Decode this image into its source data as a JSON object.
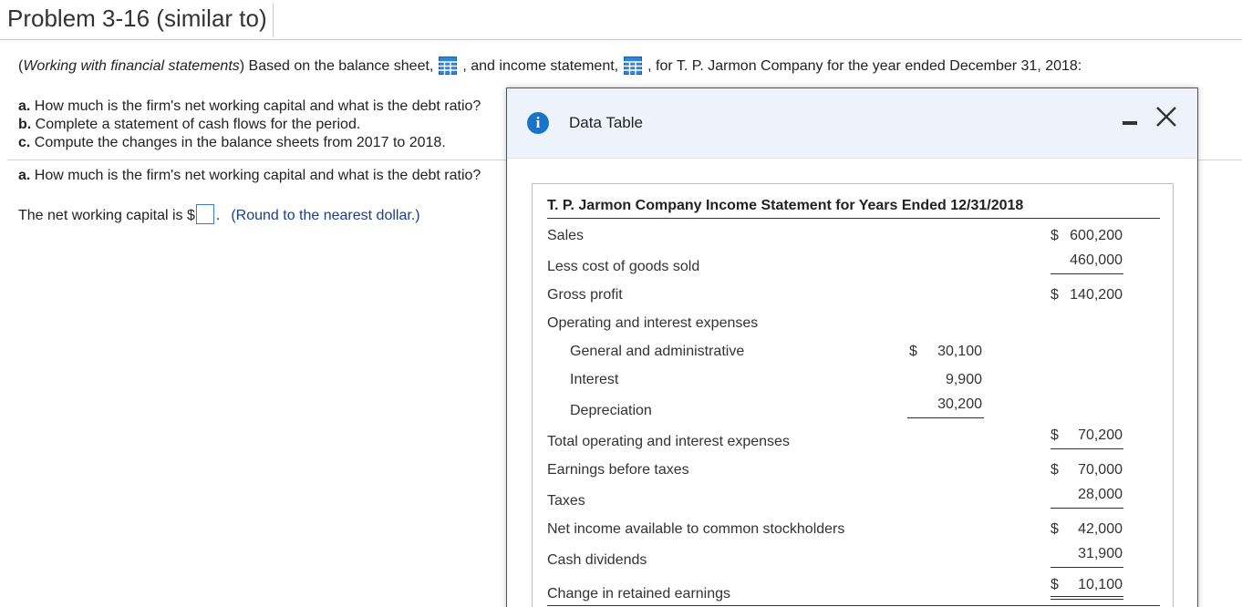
{
  "page": {
    "title": "Problem 3-16 (similar to)",
    "intro_italic": "Working with financial statements",
    "intro_pre": "(",
    "intro_mid": ") Based on the balance sheet,",
    "intro_and": ", and income statement,",
    "intro_end": ", for T. P. Jarmon Company for the year ended December 31, 2018:",
    "questions": [
      {
        "letter": "a.",
        "text": "How much is the firm's net working capital and what is the debt ratio?"
      },
      {
        "letter": "b.",
        "text": "Complete a statement of cash flows for the period."
      },
      {
        "letter": "c.",
        "text": "Compute the changes in the balance sheets from 2017 to 2018."
      }
    ],
    "part_a": {
      "letter": "a.",
      "text": "How much is the firm's net working capital and what is the debt ratio?"
    },
    "nwc_label": "The net working capital is $",
    "nwc_period": ".",
    "nwc_hint": "(Round to the nearest dollar.)"
  },
  "modal": {
    "title": "Data Table",
    "info_icon": "i",
    "statement_title": "T. P. Jarmon Company Income Statement for Years Ended 12/31/2018",
    "rows": {
      "sales": {
        "label": "Sales",
        "dollar": "$",
        "value": "600,200"
      },
      "cogs": {
        "label": "Less cost of goods sold",
        "value": "460,000"
      },
      "gross": {
        "label": "Gross profit",
        "dollar": "$",
        "value": "140,200"
      },
      "opex_header": {
        "label": "Operating and interest expenses"
      },
      "ga": {
        "label": "General and administrative",
        "dollar": "$",
        "value": "30,100"
      },
      "interest": {
        "label": "Interest",
        "value": "9,900"
      },
      "depr": {
        "label": "Depreciation",
        "value": "30,200"
      },
      "total_opex": {
        "label": "Total operating and interest expenses",
        "dollar": "$",
        "value": "70,200"
      },
      "ebt": {
        "label": "Earnings before taxes",
        "dollar": "$",
        "value": "70,000"
      },
      "taxes": {
        "label": "Taxes",
        "value": "28,000"
      },
      "net_income": {
        "label": "Net income available to common stockholders",
        "dollar": "$",
        "value": "42,000"
      },
      "dividends": {
        "label": "Cash dividends",
        "value": "31,900"
      },
      "retained": {
        "label": "Change in retained earnings",
        "dollar": "$",
        "value": "10,100"
      }
    }
  },
  "colors": {
    "accent": "#1a73c9",
    "hint": "#1b3f8f",
    "header_bg": "#eef3fb"
  }
}
